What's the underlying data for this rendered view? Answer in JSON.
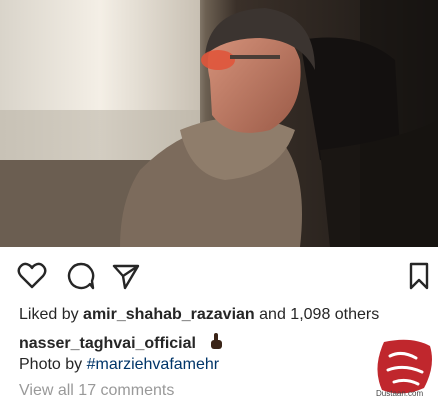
{
  "post": {
    "liked_prefix": "Liked by",
    "liked_user": "amir_shahab_razavian",
    "liked_suffix": "and 1,098 others",
    "author": "nasser_taghvai_official",
    "photo_by_label": "Photo by",
    "photo_by_tag": "#marziehvafamehr",
    "view_comments": "View all 17 comments"
  },
  "watermark": {
    "site": "Dustaan.com",
    "logo_text": "مجله دوستان"
  },
  "icons": {
    "like": "heart-icon",
    "comment": "comment-icon",
    "share": "paper-plane-icon",
    "save": "bookmark-icon",
    "emoji": "pointing-up-hand-icon"
  },
  "colors": {
    "text": "#262626",
    "hashtag": "#003569",
    "muted": "#999999",
    "watermark_red": "#c0272d"
  }
}
